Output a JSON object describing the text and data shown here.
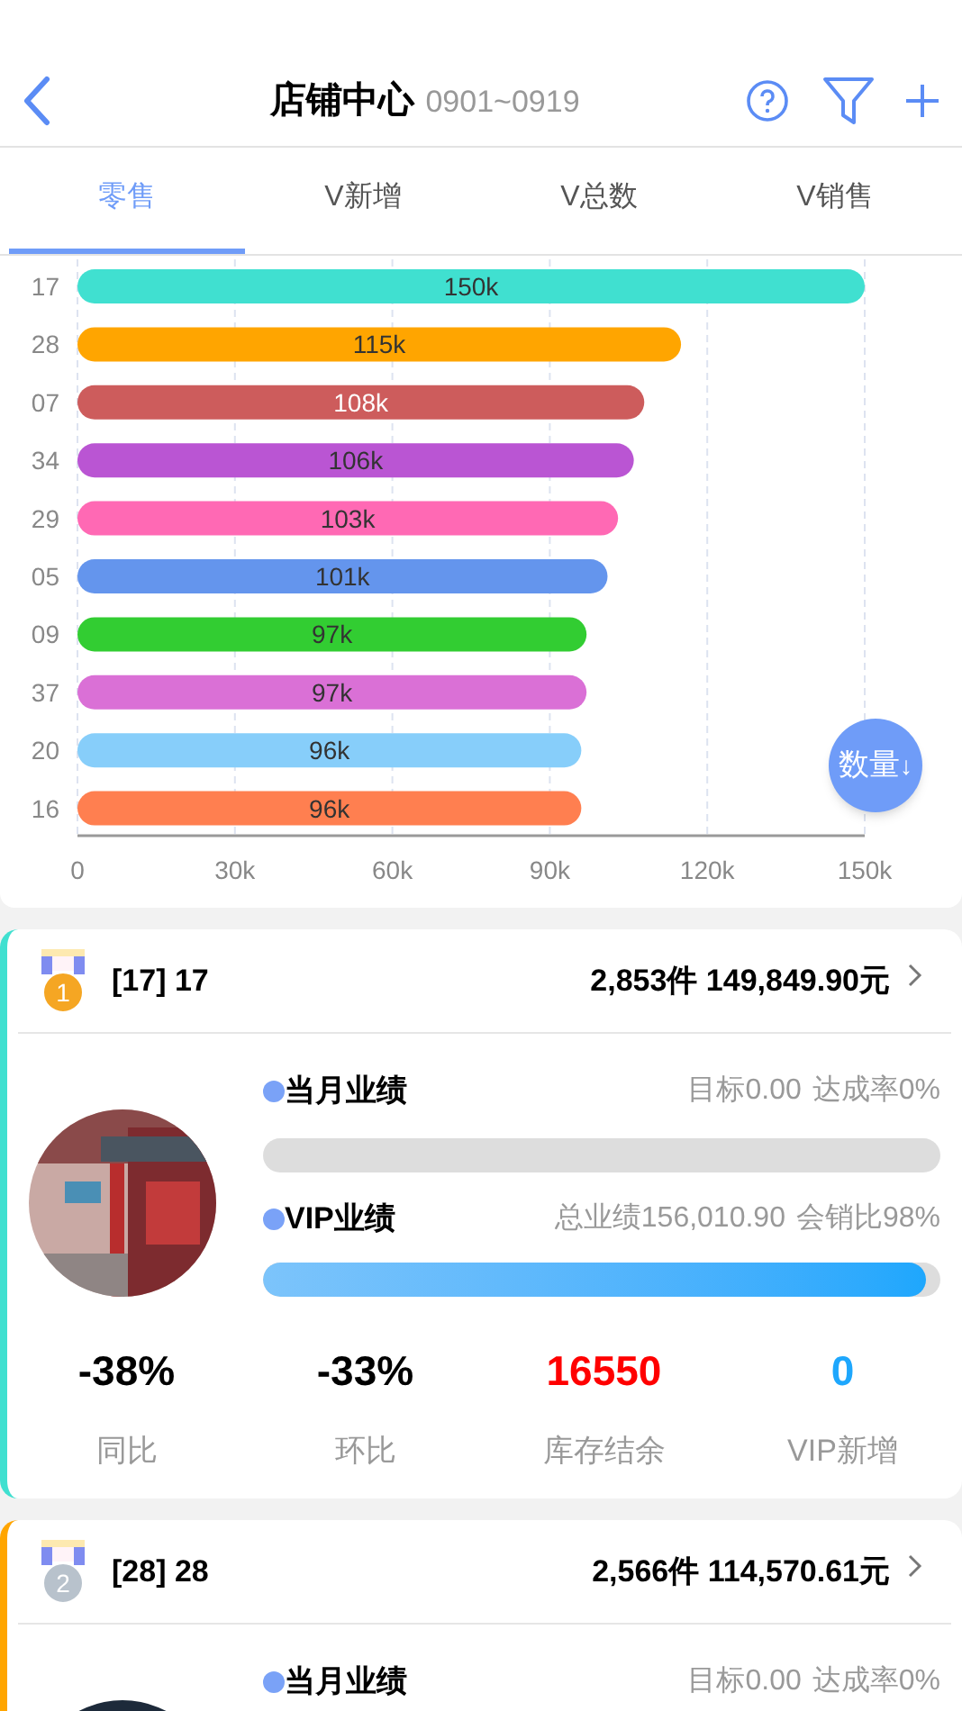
{
  "header": {
    "title": "店铺中心",
    "date_range": "0901~0919"
  },
  "tabs": [
    {
      "label": "零售",
      "selected": true
    },
    {
      "label": "V新增",
      "selected": false
    },
    {
      "label": "V总数",
      "selected": false
    },
    {
      "label": "V销售",
      "selected": false
    }
  ],
  "chart_data": {
    "type": "bar",
    "orientation": "horizontal",
    "categories": [
      "17",
      "28",
      "07",
      "34",
      "29",
      "05",
      "09",
      "37",
      "20",
      "16"
    ],
    "series": [
      {
        "values": [
          150,
          115,
          108,
          106,
          103,
          101,
          97,
          97,
          96,
          96
        ]
      }
    ],
    "grid": true,
    "colors": [
      "#40e0d0",
      "#ffa500",
      "#cd5c5c",
      "#ba55d3",
      "#ff69b4",
      "#6495ed",
      "#32cd32",
      "#da70d6",
      "#87cefa",
      "#ff7f50"
    ],
    "xlim": [
      0,
      150
    ],
    "xticks": [
      {
        "value": 0,
        "label": "0"
      },
      {
        "value": 30,
        "label": "30k"
      },
      {
        "value": 60,
        "label": "60k"
      },
      {
        "value": 90,
        "label": "90k"
      },
      {
        "value": 120,
        "label": "120k"
      },
      {
        "value": 150,
        "label": "150k"
      }
    ],
    "value_labels": [
      "150k",
      "115k",
      "108k",
      "106k",
      "103k",
      "101k",
      "97k",
      "97k",
      "96k",
      "96k"
    ]
  },
  "sort_button": {
    "label": "数量",
    "arrow": "↓"
  },
  "stores": [
    {
      "color": "#40e0d0",
      "medal": {
        "rank": "1",
        "color": "#f5a623"
      },
      "name": "[17] 17",
      "totals": "2,853件 149,849.90元",
      "month": {
        "label": "当月业绩",
        "target": "目标0.00",
        "rate": "达成率0%",
        "level": 0
      },
      "vip": {
        "label": "VIP业绩",
        "total": "总业绩156,010.90",
        "ratio": "会销比98%",
        "level": 0.98
      },
      "stats": [
        {
          "value": "-38%",
          "label": "同比",
          "color": "#000000"
        },
        {
          "value": "-33%",
          "label": "环比",
          "color": "#000000"
        },
        {
          "value": "16550",
          "label": "库存结余",
          "color": "#ff0000"
        },
        {
          "value": "0",
          "label": "VIP新增",
          "color": "#1ea7fd"
        }
      ]
    },
    {
      "color": "#ffa500",
      "medal": {
        "rank": "2",
        "color": "#b8c2cc"
      },
      "name": "[28] 28",
      "totals": "2,566件 114,570.61元",
      "month": {
        "label": "当月业绩",
        "target": "目标0.00",
        "rate": "达成率0%"
      }
    }
  ]
}
